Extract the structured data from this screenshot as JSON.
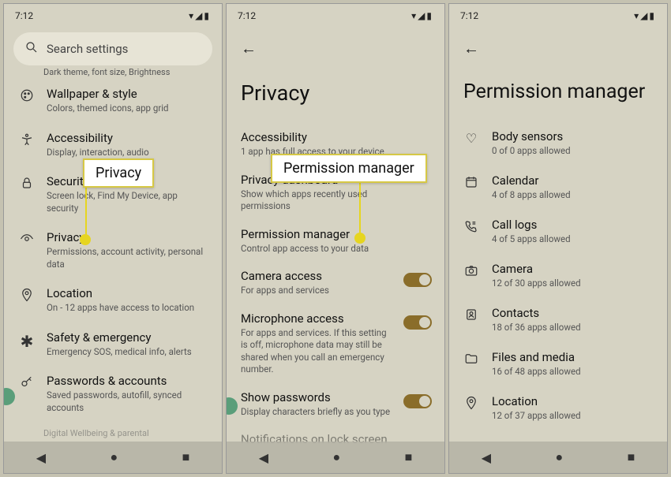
{
  "status": {
    "time": "7:12",
    "icons": "▾◢▮"
  },
  "p1": {
    "search": "Search settings",
    "truncated": "Dark theme, font size, Brightness",
    "items": [
      {
        "t": "Wallpaper & style",
        "s": "Colors, themed icons, app grid"
      },
      {
        "t": "Accessibility",
        "s": "Display, interaction, audio"
      },
      {
        "t": "Security",
        "s": "Screen lock, Find My Device, app security"
      },
      {
        "t": "Privacy",
        "s": "Permissions, account activity, personal data"
      },
      {
        "t": "Location",
        "s": "On - 12 apps have access to location"
      },
      {
        "t": "Safety & emergency",
        "s": "Emergency SOS, medical info, alerts"
      },
      {
        "t": "Passwords & accounts",
        "s": "Saved passwords, autofill, synced accounts"
      }
    ],
    "cut": "Digital Wellbeing & parental",
    "callout": "Privacy"
  },
  "p2": {
    "title": "Privacy",
    "items": [
      {
        "t": "Accessibility",
        "s": "1 app has full access to your device"
      },
      {
        "t": "Privacy dashboard",
        "s": "Show which apps recently used permissions"
      },
      {
        "t": "Permission manager",
        "s": "Control app access to your data"
      },
      {
        "t": "Camera access",
        "s": "For apps and services",
        "tog": true
      },
      {
        "t": "Microphone access",
        "s": "For apps and services. If this setting is off, microphone data may still be shared when you call an emergency number.",
        "tog": true
      },
      {
        "t": "Show passwords",
        "s": "Display characters briefly as you type",
        "tog": true
      }
    ],
    "cut": "Notifications on lock screen",
    "callout": "Permission manager"
  },
  "p3": {
    "title": "Permission manager",
    "items": [
      {
        "t": "Body sensors",
        "s": "0 of 0 apps allowed"
      },
      {
        "t": "Calendar",
        "s": "4 of 8 apps allowed"
      },
      {
        "t": "Call logs",
        "s": "4 of 5 apps allowed"
      },
      {
        "t": "Camera",
        "s": "12 of 30 apps allowed"
      },
      {
        "t": "Contacts",
        "s": "18 of 36 apps allowed"
      },
      {
        "t": "Files and media",
        "s": "16 of 48 apps allowed"
      },
      {
        "t": "Location",
        "s": "12 of 37 apps allowed"
      }
    ]
  }
}
